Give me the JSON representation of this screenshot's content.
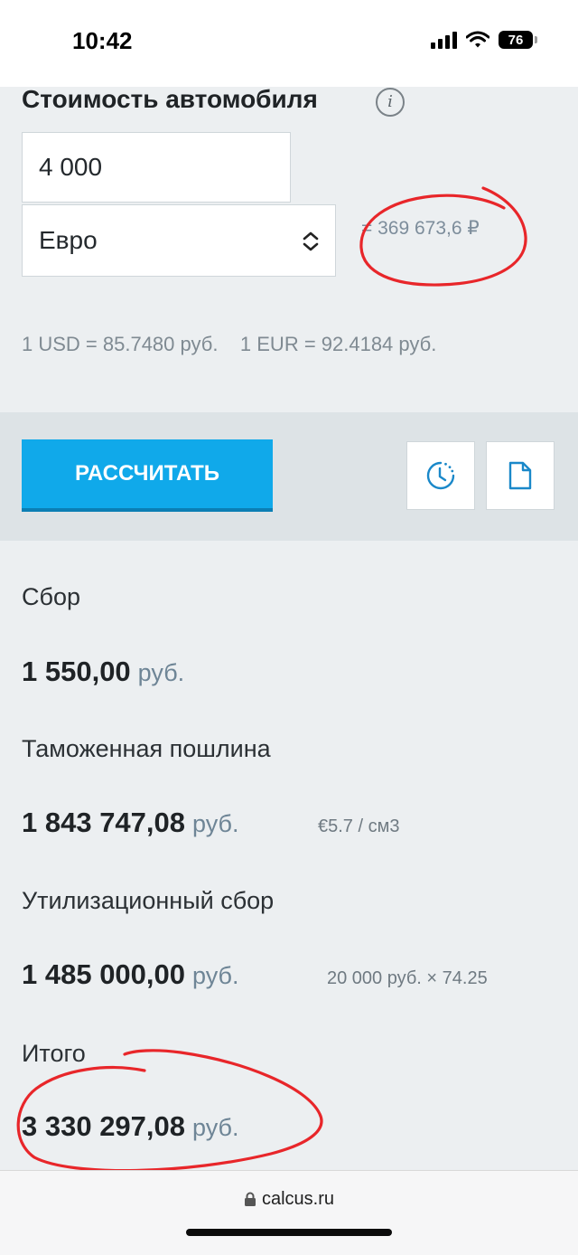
{
  "status": {
    "time": "10:42",
    "battery": "76"
  },
  "form": {
    "title": "Стоимость автомобиля",
    "price_value": "4 000",
    "currency_selected": "Евро",
    "converted": "= 369 673,6 ₽",
    "rates": "1 USD = 85.7480 руб.    1 EUR = 92.4184 руб."
  },
  "actions": {
    "calculate_label": "РАССЧИТАТЬ"
  },
  "results": [
    {
      "label": "Сбор",
      "value": "1 550,00",
      "unit": "руб.",
      "note": ""
    },
    {
      "label": "Таможенная пошлина",
      "value": "1 843 747,08",
      "unit": "руб.",
      "note": "€5.7 / см3"
    },
    {
      "label": "Утилизационный сбор",
      "value": "1 485 000,00",
      "unit": "руб.",
      "note": "20 000 руб. × 74.25"
    },
    {
      "label": "Итого",
      "value": "3 330 297,08",
      "unit": "руб.",
      "note": ""
    }
  ],
  "browser": {
    "url": "calcus.ru"
  },
  "colors": {
    "accent": "#10a9ea",
    "annotation": "#e8262a"
  }
}
